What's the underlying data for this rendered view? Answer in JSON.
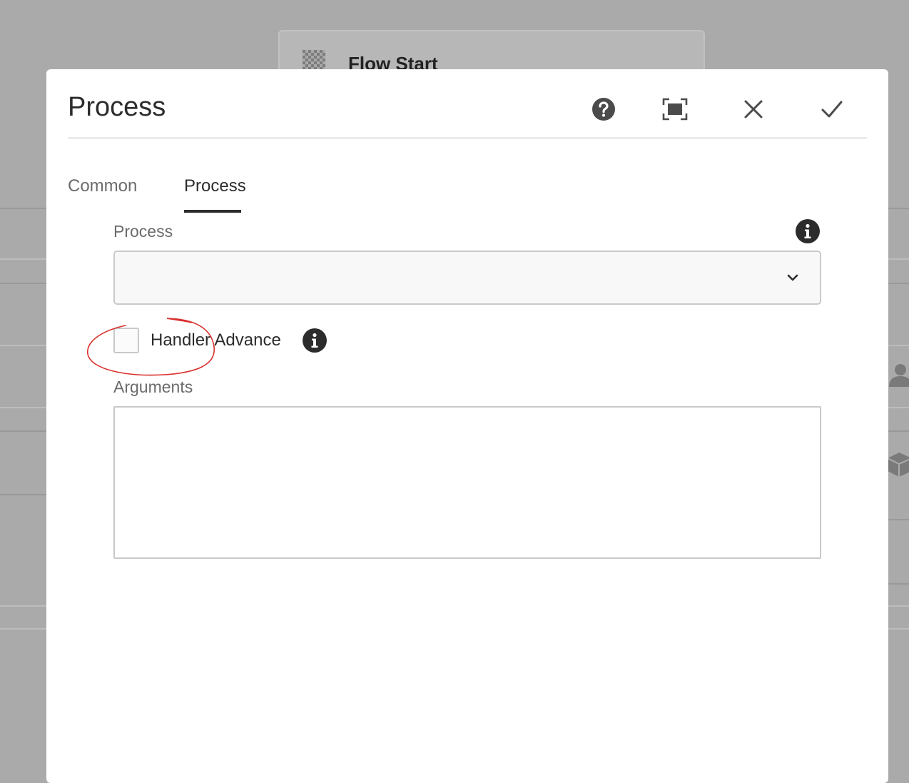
{
  "background": {
    "card_title": "Flow Start"
  },
  "dialog": {
    "title": "Process",
    "buttons": {
      "help": "help-icon",
      "fullscreen": "fullscreen-icon",
      "close": "close-icon",
      "done": "checkmark-icon"
    },
    "tabs": [
      {
        "label": "Common",
        "active": false
      },
      {
        "label": "Process",
        "active": true
      }
    ],
    "process_field": {
      "label": "Process",
      "value": ""
    },
    "handler_advance": {
      "label": "Handler Advance",
      "checked": false
    },
    "arguments_field": {
      "label": "Arguments",
      "value": ""
    }
  },
  "colors": {
    "annotation": "#d9302c",
    "text_dark": "#2c2c2c",
    "text_muted": "#6b6b6b",
    "overlay": "#aaaaaa"
  }
}
